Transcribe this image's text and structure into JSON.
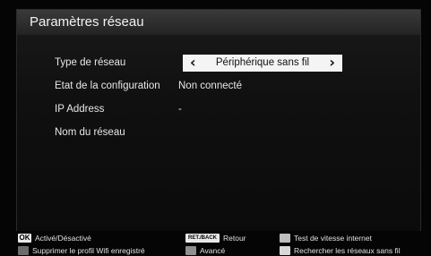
{
  "panel": {
    "title": "Paramètres réseau"
  },
  "settings": {
    "network_type": {
      "label": "Type de réseau",
      "value": "Périphérique sans fil"
    },
    "config_state": {
      "label": "Etat de la configuration",
      "value": "Non connecté"
    },
    "ip_address": {
      "label": "IP Address",
      "value": "-"
    },
    "network_name": {
      "label": "Nom du réseau",
      "value": ""
    }
  },
  "footer": {
    "ok_key": "OK",
    "ok_label": "Activé/Désactivé",
    "back_key": "RET./BACK",
    "back_label": "Retour",
    "speed_test_label": "Test de vitesse internet",
    "delete_wifi_label": "Supprimer le profil Wifi enregistré",
    "advanced_label": "Avancé",
    "search_networks_label": "Rechercher les réseaux sans fil"
  },
  "colors": {
    "background": "#050505",
    "title_bar": "#2e2e2e",
    "selector_bg": "#f4f4f4",
    "text": "#ffffff"
  }
}
